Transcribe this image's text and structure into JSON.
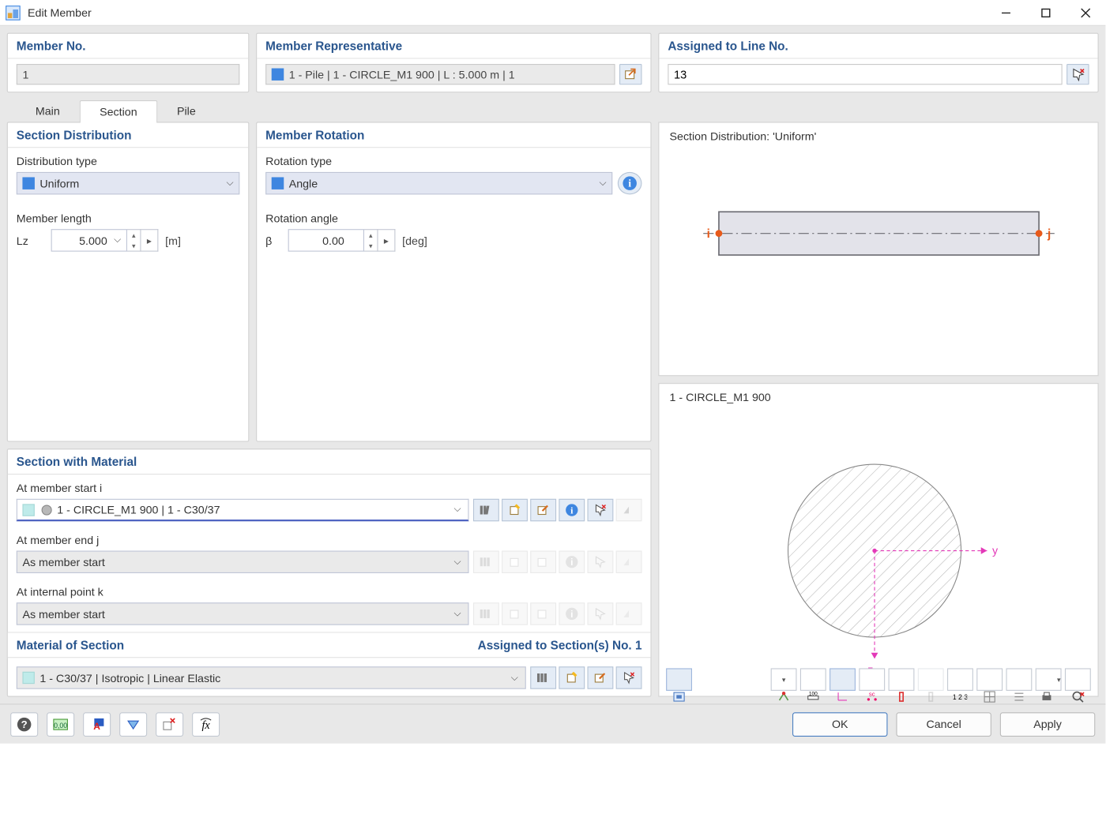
{
  "window": {
    "title": "Edit Member"
  },
  "header": {
    "member_no": {
      "label": "Member No.",
      "value": "1"
    },
    "member_rep": {
      "label": "Member Representative",
      "value": "1 - Pile | 1 - CIRCLE_M1 900 | L : 5.000 m | 1"
    },
    "assigned_line": {
      "label": "Assigned to Line No.",
      "value": "13"
    }
  },
  "tabs": {
    "main": "Main",
    "section": "Section",
    "pile": "Pile"
  },
  "section_dist": {
    "title": "Section Distribution",
    "dist_type_label": "Distribution type",
    "dist_type_value": "Uniform",
    "length_label": "Member length",
    "length_sym": "Lz",
    "length_value": "5.000",
    "length_unit": "[m]"
  },
  "member_rot": {
    "title": "Member Rotation",
    "rot_type_label": "Rotation type",
    "rot_type_value": "Angle",
    "angle_label": "Rotation angle",
    "angle_sym": "β",
    "angle_value": "0.00",
    "angle_unit": "[deg]"
  },
  "sec_mat": {
    "title": "Section with Material",
    "start_label": "At member start i",
    "start_value": "1 - CIRCLE_M1 900 | 1 - C30/37",
    "end_label": "At member end j",
    "end_value": "As member start",
    "int_label": "At internal point k",
    "int_value": "As member start"
  },
  "mat_sec": {
    "title": "Material of Section",
    "assigned_label": "Assigned to Section(s) No. 1",
    "value": "1 - C30/37 | Isotropic | Linear Elastic"
  },
  "preview": {
    "dist_title": "Section Distribution: 'Uniform'",
    "i": "i",
    "j": "j",
    "sec_title": "1 - CIRCLE_M1 900",
    "y": "y",
    "z": "z"
  },
  "footer": {
    "ok": "OK",
    "cancel": "Cancel",
    "apply": "Apply"
  }
}
